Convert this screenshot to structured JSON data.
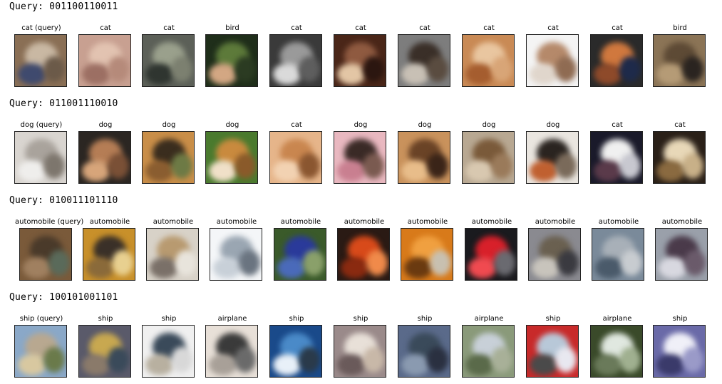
{
  "rows": [
    {
      "query_heading": "Query: 001100110011",
      "items": [
        {
          "label": "cat (query)",
          "colors": [
            "#8a6f55",
            "#c9b8a3",
            "#3f4a6e",
            "#6b5a49"
          ]
        },
        {
          "label": "cat",
          "colors": [
            "#c8a091",
            "#e2c3b1",
            "#9c6f63",
            "#b58a7a"
          ]
        },
        {
          "label": "cat",
          "colors": [
            "#5c6058",
            "#9aa08c",
            "#2f3530",
            "#7c8070"
          ]
        },
        {
          "label": "bird",
          "colors": [
            "#1f2e1a",
            "#5d7a3a",
            "#d3a783",
            "#2b3b22"
          ]
        },
        {
          "label": "cat",
          "colors": [
            "#3a3a3a",
            "#9a9a9a",
            "#dadada",
            "#5e5e5e"
          ]
        },
        {
          "label": "cat",
          "colors": [
            "#4a2618",
            "#8f5a40",
            "#e3c6a5",
            "#2b1610"
          ]
        },
        {
          "label": "cat",
          "colors": [
            "#7d7d7d",
            "#3a2f28",
            "#c8c0b5",
            "#5a4c40"
          ]
        },
        {
          "label": "cat",
          "colors": [
            "#c98a55",
            "#e9c6a0",
            "#a55d2f",
            "#d8a577"
          ]
        },
        {
          "label": "cat",
          "colors": [
            "#f4f4f4",
            "#b5896a",
            "#e0d6cc",
            "#8f6b52"
          ]
        },
        {
          "label": "cat",
          "colors": [
            "#2a2a2a",
            "#d0783e",
            "#8e4a2a",
            "#1e2a4a"
          ]
        },
        {
          "label": "bird",
          "colors": [
            "#8b7456",
            "#5d4a35",
            "#b59b76",
            "#2a2420"
          ]
        }
      ]
    },
    {
      "query_heading": "Query: 011001110010",
      "items": [
        {
          "label": "dog (query)",
          "colors": [
            "#d9d5d0",
            "#a9a39c",
            "#efeeec",
            "#7d766d"
          ]
        },
        {
          "label": "dog",
          "colors": [
            "#2b2622",
            "#b57d55",
            "#d7a57a",
            "#7a5036"
          ]
        },
        {
          "label": "dog",
          "colors": [
            "#c98e48",
            "#3a2d1e",
            "#8a5d30",
            "#6d7a45"
          ]
        },
        {
          "label": "dog",
          "colors": [
            "#4a7a2e",
            "#c98a3e",
            "#f0e0c8",
            "#8a5a2a"
          ]
        },
        {
          "label": "cat",
          "colors": [
            "#e6b58a",
            "#c9864f",
            "#f2d2b2",
            "#8a5630"
          ]
        },
        {
          "label": "dog",
          "colors": [
            "#e9b8c0",
            "#3a2a26",
            "#c97f90",
            "#7a5a50"
          ]
        },
        {
          "label": "dog",
          "colors": [
            "#c9925c",
            "#6a4326",
            "#e8bd8a",
            "#3a2418"
          ]
        },
        {
          "label": "dog",
          "colors": [
            "#b8a892",
            "#7a5a3a",
            "#d8c8b0",
            "#9a7a5a"
          ]
        },
        {
          "label": "dog",
          "colors": [
            "#eae6e0",
            "#2a2420",
            "#c06030",
            "#7a6a5a"
          ]
        },
        {
          "label": "cat",
          "colors": [
            "#1a1a2a",
            "#f0f0f0",
            "#5a3a4a",
            "#c8c8d0"
          ]
        },
        {
          "label": "cat",
          "colors": [
            "#2a2018",
            "#e8d8b8",
            "#8a6a40",
            "#c8b088"
          ]
        }
      ]
    },
    {
      "query_heading": "Query: 010011101110",
      "items": [
        {
          "label": "automobile (query)",
          "colors": [
            "#7a5a3a",
            "#4a3a2a",
            "#a08060",
            "#5a6a5a"
          ]
        },
        {
          "label": "automobile",
          "colors": [
            "#c8902a",
            "#3a3028",
            "#8a6a3a",
            "#e8d090"
          ]
        },
        {
          "label": "automobile",
          "colors": [
            "#d8d2c8",
            "#b89a70",
            "#7a7068",
            "#e8e4dc"
          ]
        },
        {
          "label": "automobile",
          "colors": [
            "#f4f6f8",
            "#9aa6b2",
            "#c8d0d8",
            "#6a7480"
          ]
        },
        {
          "label": "automobile",
          "colors": [
            "#3a5a2a",
            "#2a3a9a",
            "#4a6aba",
            "#8aa06a"
          ]
        },
        {
          "label": "automobile",
          "colors": [
            "#2a1a14",
            "#d84a1a",
            "#8a2a10",
            "#f08a4a"
          ]
        },
        {
          "label": "automobile",
          "colors": [
            "#d87a1a",
            "#f0a040",
            "#6a3a10",
            "#c8c0b0"
          ]
        },
        {
          "label": "automobile",
          "colors": [
            "#1a1a1e",
            "#d8202a",
            "#f04a50",
            "#6a6a70"
          ]
        },
        {
          "label": "automobile",
          "colors": [
            "#8a8a90",
            "#6a6050",
            "#c8c4bc",
            "#3a3a40"
          ]
        },
        {
          "label": "automobile",
          "colors": [
            "#7a8a9a",
            "#a8b0b8",
            "#4a5a6a",
            "#c8ccd0"
          ]
        },
        {
          "label": "automobile",
          "colors": [
            "#9aa0aa",
            "#4a3a4a",
            "#d8d8e0",
            "#6a5a6a"
          ]
        }
      ]
    },
    {
      "query_heading": "Query: 100101001101",
      "items": [
        {
          "label": "ship (query)",
          "colors": [
            "#8aa8c8",
            "#b8a890",
            "#d8c8a0",
            "#6a7a4a"
          ]
        },
        {
          "label": "ship",
          "colors": [
            "#5a5a6a",
            "#c8a850",
            "#8a7a6a",
            "#3a4a5a"
          ]
        },
        {
          "label": "ship",
          "colors": [
            "#f0f0f0",
            "#3a4a5a",
            "#b8b0a0",
            "#d8d8d8"
          ]
        },
        {
          "label": "airplane",
          "colors": [
            "#e8e0d8",
            "#3a3a3a",
            "#a8a098",
            "#6a6a6a"
          ]
        },
        {
          "label": "ship",
          "colors": [
            "#1a4a8a",
            "#4a8ac8",
            "#e8f0f8",
            "#2a3a4a"
          ]
        },
        {
          "label": "ship",
          "colors": [
            "#9a8a8a",
            "#e8e0d8",
            "#6a5a5a",
            "#c8b8a8"
          ]
        },
        {
          "label": "ship",
          "colors": [
            "#5a6a8a",
            "#3a4a5a",
            "#8a9ab0",
            "#2a3040"
          ]
        },
        {
          "label": "airplane",
          "colors": [
            "#8a9a7a",
            "#c8d0d8",
            "#5a6a4a",
            "#a8b098"
          ]
        },
        {
          "label": "ship",
          "colors": [
            "#c82a2a",
            "#b8c8d8",
            "#4a4a4a",
            "#e8e8f0"
          ]
        },
        {
          "label": "airplane",
          "colors": [
            "#3a4a2a",
            "#e0e8e0",
            "#6a7a5a",
            "#a0b090"
          ]
        },
        {
          "label": "ship",
          "colors": [
            "#6a6aa8",
            "#f0f0f8",
            "#3a3a6a",
            "#9a9ac8"
          ]
        }
      ]
    }
  ]
}
